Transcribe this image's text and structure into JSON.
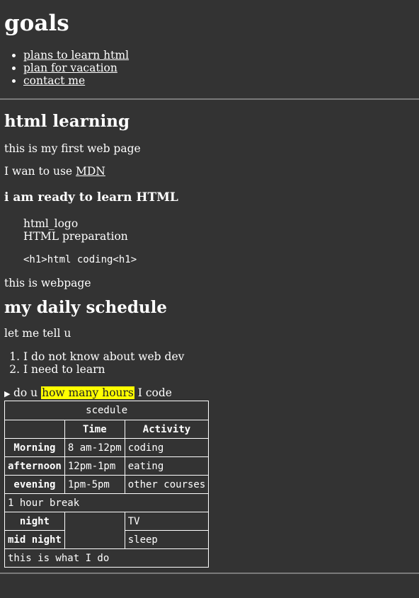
{
  "header": {
    "title": "goals",
    "nav": [
      "plans to learn html",
      "plan for vacation",
      "contact me"
    ]
  },
  "learning": {
    "heading": "html learning",
    "p1": "this is my first web page",
    "p2_prefix": "I wan to use ",
    "p2_link": "MDN",
    "subheading": "i am ready to learn HTML",
    "quote_line1": "html_logo",
    "quote_line2": "HTML preparation",
    "code": "<h1>html coding<h1>",
    "p3": "this is webpage"
  },
  "schedule": {
    "heading": "my daily schedule",
    "intro": "let me tell u",
    "list": [
      "I do not know about web dev",
      "I need to learn"
    ],
    "details_prefix": "do u ",
    "details_mark": "how many hours",
    "details_suffix": " I code",
    "table": {
      "caption": "scedule",
      "headers": [
        "",
        "Time",
        "Activity"
      ],
      "rows": [
        {
          "label": "Morning",
          "time": "8 am-12pm",
          "activity": "coding"
        },
        {
          "label": "afternoon",
          "time": "12pm-1pm",
          "activity": "eating"
        },
        {
          "label": "evening",
          "time": "1pm-5pm",
          "activity": "other courses"
        }
      ],
      "break_row": "1 hour break",
      "night_rows": [
        {
          "label": "night",
          "activity": "TV"
        },
        {
          "label": "mid night",
          "activity": "sleep"
        }
      ],
      "footer": "this is what I do"
    }
  },
  "colors": {
    "background": "#333333",
    "text": "#ffffff",
    "highlight": "#ffff00",
    "rule": "#7a7a7a"
  }
}
